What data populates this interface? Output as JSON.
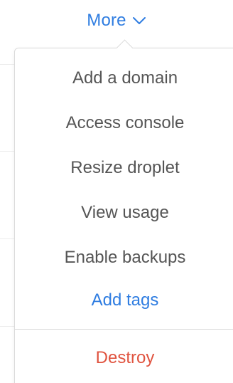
{
  "toggle": {
    "label": "More",
    "icon": "chevron-down-icon",
    "color": "#2f7de1"
  },
  "menu": {
    "items": [
      {
        "label": "Add a domain"
      },
      {
        "label": "Access console"
      },
      {
        "label": "Resize droplet"
      },
      {
        "label": "View usage"
      },
      {
        "label": "Enable backups"
      },
      {
        "label": "Add tags",
        "color": "#2f7de1"
      }
    ],
    "danger_item": {
      "label": "Destroy",
      "color": "#e0533f"
    }
  }
}
